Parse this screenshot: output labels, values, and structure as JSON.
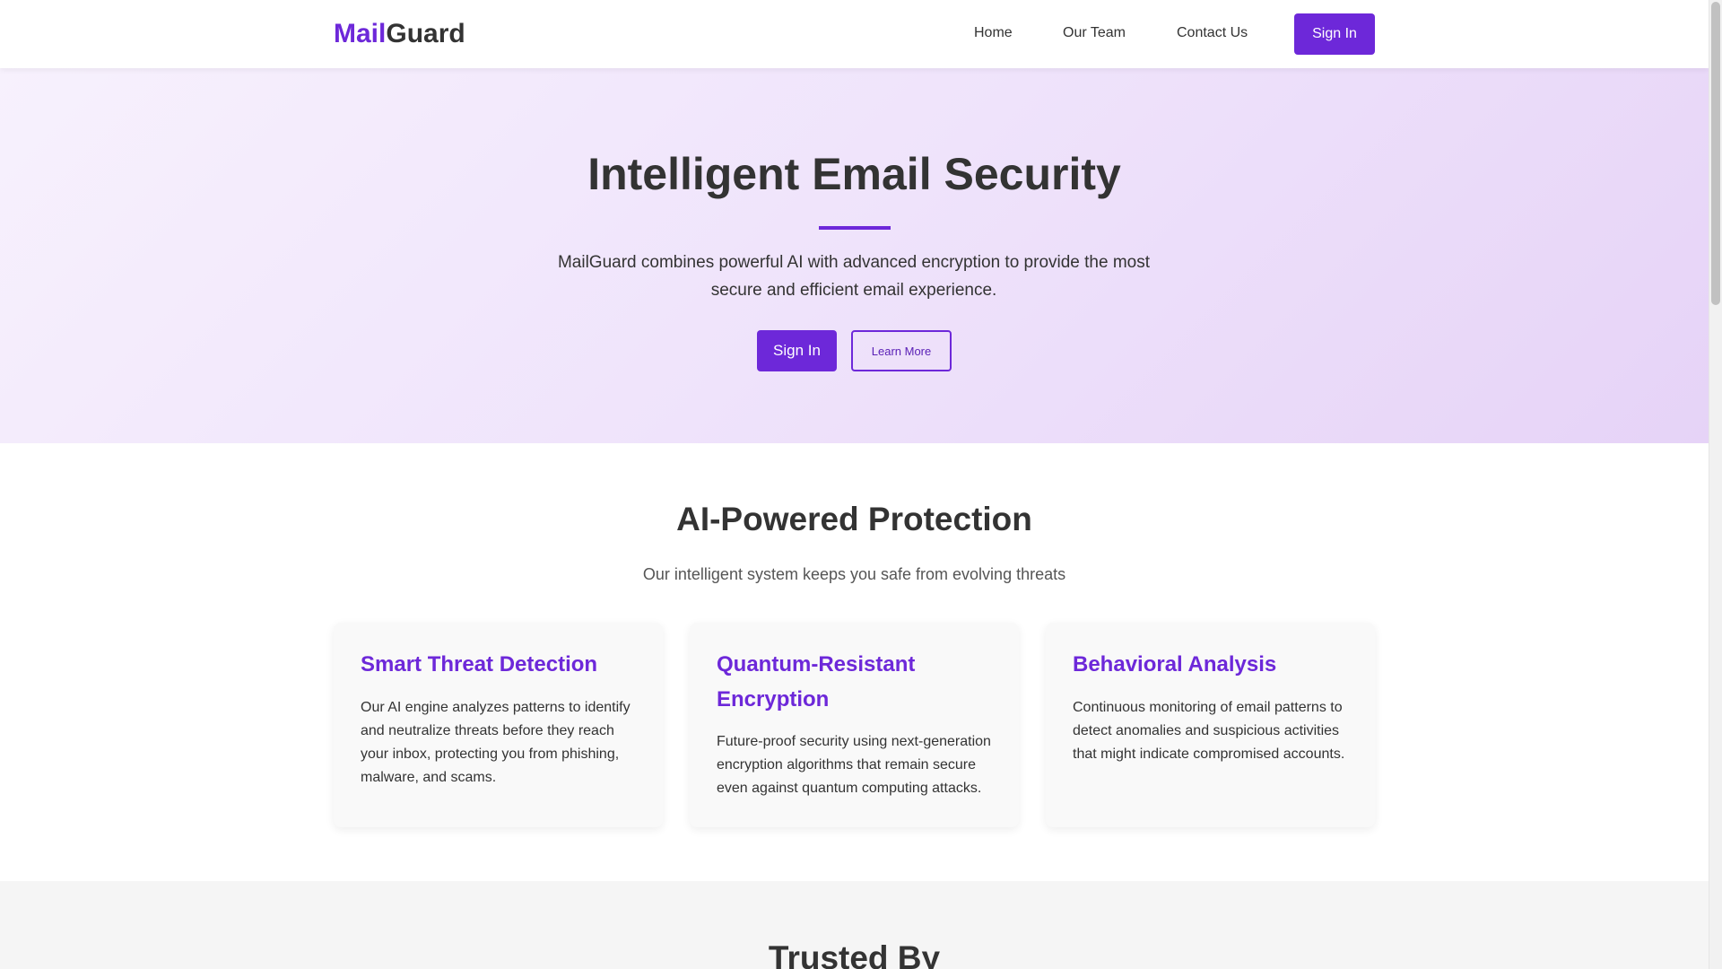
{
  "header": {
    "logo_accent": "Mail",
    "logo_rest": "Guard",
    "nav": {
      "home": "Home",
      "team": "Our Team",
      "contact": "Contact Us"
    },
    "signin_label": "Sign In"
  },
  "hero": {
    "title": "Intelligent Email Security",
    "subtitle": "MailGuard combines powerful AI with advanced encryption to provide the most secure and efficient email experience.",
    "signin_label": "Sign In",
    "learn_more_label": "Learn More"
  },
  "features": {
    "title": "AI-Powered Protection",
    "subtitle": "Our intelligent system keeps you safe from evolving threats",
    "cards": [
      {
        "title": "Smart Threat Detection",
        "text": "Our AI engine analyzes patterns to identify and neutralize threats before they reach your inbox, protecting you from phishing, malware, and scams."
      },
      {
        "title": "Quantum-Resistant Encryption",
        "text": "Future-proof security using next-generation encryption algorithms that remain secure even against quantum computing attacks."
      },
      {
        "title": "Behavioral Analysis",
        "text": "Continuous monitoring of email patterns to detect anomalies and suspicious activities that might indicate compromised accounts."
      }
    ]
  },
  "trusted": {
    "title": "Trusted By"
  },
  "colors": {
    "accent": "#6d28d9",
    "text": "#333333",
    "hero_gradient_start": "#f7f1fd",
    "hero_gradient_end": "#e6d3f7",
    "section_gray": "#f5f5f5"
  }
}
